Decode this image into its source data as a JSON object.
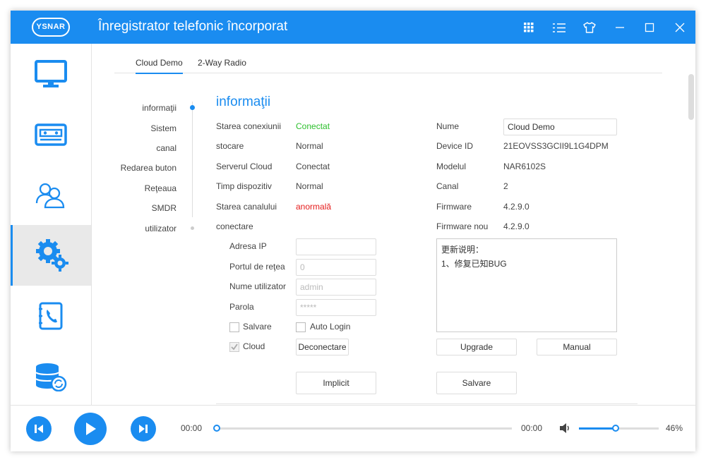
{
  "app": {
    "logo_text": "YSNAR",
    "title": "Înregistrator telefonic încorporat",
    "accent_color": "#1a8cf0"
  },
  "titlebar_icons": [
    "grid-icon",
    "list-icon",
    "skin-icon",
    "minimize-icon",
    "maximize-icon",
    "close-icon"
  ],
  "sidebar": {
    "items": [
      {
        "name": "monitor-icon",
        "active": false
      },
      {
        "name": "cassette-icon",
        "active": false
      },
      {
        "name": "users-icon",
        "active": false
      },
      {
        "name": "settings-gears-icon",
        "active": true
      },
      {
        "name": "phonebook-icon",
        "active": false
      },
      {
        "name": "database-sync-icon",
        "active": false
      }
    ]
  },
  "tabs": [
    {
      "label": "Cloud Demo",
      "active": true
    },
    {
      "label": "2-Way Radio",
      "active": false
    }
  ],
  "subnav": [
    "informaţii",
    "Sistem",
    "canal",
    "Redarea buton",
    "Reţeaua",
    "SMDR",
    "utilizator"
  ],
  "section_title": "informaţii",
  "info_left": [
    {
      "label": "Starea conexiunii",
      "value": "Conectat",
      "status": "ok"
    },
    {
      "label": "stocare",
      "value": "Normal",
      "status": "normal"
    },
    {
      "label": "Serverul Cloud",
      "value": "Conectat",
      "status": "normal"
    },
    {
      "label": "Timp dispozitiv",
      "value": "Normal",
      "status": "normal"
    },
    {
      "label": "Starea canalului",
      "value": "anormală",
      "status": "error"
    }
  ],
  "connect": {
    "heading": "conectare",
    "ip_label": "Adresa IP",
    "ip_value": "",
    "port_label": "Portul de reţea",
    "port_placeholder": "0",
    "user_label": "Nume utilizator",
    "user_placeholder": "admin",
    "password_label": "Parola",
    "password_placeholder": "*****",
    "save_label": "Salvare",
    "save_checked": false,
    "autologin_label": "Auto Login",
    "autologin_checked": false,
    "cloud_label": "Cloud",
    "cloud_checked": true,
    "disconnect_label": "Deconectare"
  },
  "info_right": {
    "name_label": "Nume",
    "name_value": "Cloud Demo",
    "device_id_label": "Device ID",
    "device_id_value": "21EOVSS3GCII9L1G4DPM",
    "model_label": "Modelul",
    "model_value": "NAR6102S",
    "channel_label": "Canal",
    "channel_value": "2",
    "firmware_label": "Firmware",
    "firmware_value": "4.2.9.0",
    "new_firmware_label": "Firmware nou",
    "new_firmware_value": "4.2.9.0",
    "notes_line1": "更新说明：",
    "notes_line2": "1、修复已知BUG",
    "upgrade_label": "Upgrade",
    "manual_label": "Manual"
  },
  "actions": {
    "default_label": "Implicit",
    "save_label": "Salvare"
  },
  "player": {
    "current_time": "00:00",
    "total_time": "00:00",
    "progress": 0,
    "volume_percent": 46,
    "volume_label": "46%"
  }
}
